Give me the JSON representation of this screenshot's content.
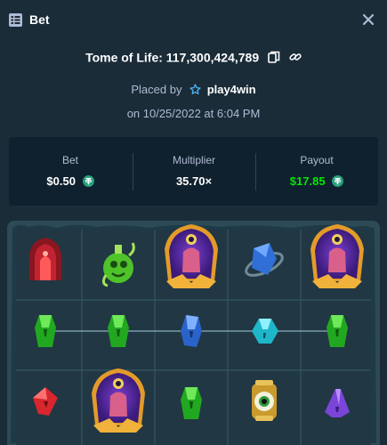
{
  "header": {
    "title": "Bet",
    "icon": "bet-list-icon",
    "close_icon": "close-icon"
  },
  "bet": {
    "game_name": "Tome of Life",
    "bet_id": "117,300,424,789",
    "id_text": "Tome of Life: 117,300,424,789",
    "placed_by_label": "Placed by",
    "username": "play4win",
    "date_text": "on 10/25/2022 at 6:04 PM"
  },
  "stats": {
    "bet": {
      "label": "Bet",
      "value": "$0.50"
    },
    "multiplier": {
      "label": "Multiplier",
      "value": "35.70×"
    },
    "payout": {
      "label": "Payout",
      "value": "$17.85"
    }
  },
  "colors": {
    "background": "#1a2c38",
    "panel": "#0f212e",
    "muted_text": "#b1bad3",
    "payout_green": "#00e701",
    "tether": "#26a17b",
    "star_accent": "#4fb3f4"
  },
  "reels": {
    "columns": 5,
    "rows": 3,
    "grid": [
      [
        "red-shrine",
        "green-potion",
        "purple-mage",
        "blue-gem",
        "purple-mage"
      ],
      [
        "green-crystal",
        "green-crystal",
        "blue-crystal",
        "cyan-crystal",
        "green-crystal"
      ],
      [
        "red-gem",
        "purple-mage",
        "green-crystal",
        "golden-eye",
        "purple-crystal"
      ]
    ]
  }
}
